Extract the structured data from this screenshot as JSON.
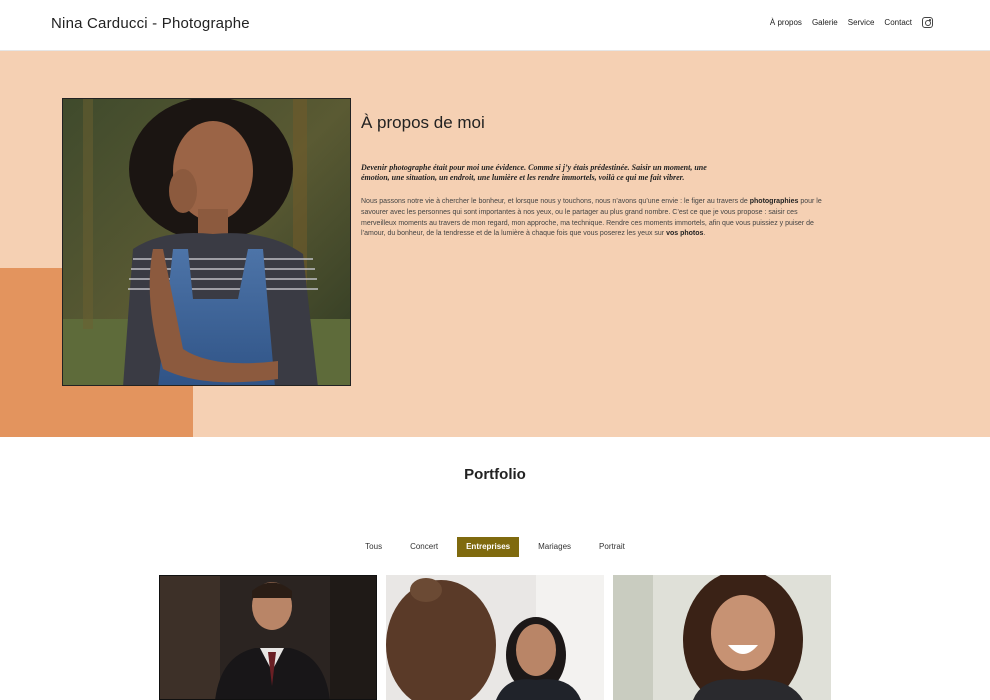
{
  "header": {
    "brand": "Nina Carducci - Photographe",
    "nav": [
      "À propos",
      "Galerie",
      "Service",
      "Contact"
    ],
    "social_icon": "instagram-icon"
  },
  "about": {
    "title": "À propos de moi",
    "quote": "Devenir photographe était pour moi une évidence. Comme si j’y étais prédestinée. Saisir un moment, une émotion, une situation, un endroit, une lumière et les rendre immortels, voilà ce qui me fait vibrer.",
    "body_1": "Nous passons notre vie à chercher le bonheur, et lorsque nous y touchons, nous n’avons qu’une envie : le figer au travers de ",
    "body_bold_1": "photographies",
    "body_2": " pour le savourer avec les personnes qui sont importantes à nos yeux, ou le partager au plus grand nombre. C’est ce que je vous propose : saisir ces merveilleux moments au travers de mon regard, mon approche, ma technique. Rendre ces moments immortels, afin que vous puissiez y puiser de l’amour, du bonheur, de la tendresse et de la lumière à chaque fois que vous poserez les yeux sur ",
    "body_bold_2": "vos photos",
    "body_3": ".",
    "colors": {
      "background": "#f5d0b3",
      "accent": "#e3945e"
    }
  },
  "portfolio": {
    "title": "Portfolio",
    "filters": [
      "Tous",
      "Concert",
      "Entreprises",
      "Mariages",
      "Portrait"
    ],
    "active_filter": "Entreprises",
    "active_color": "#7f6a0e"
  }
}
